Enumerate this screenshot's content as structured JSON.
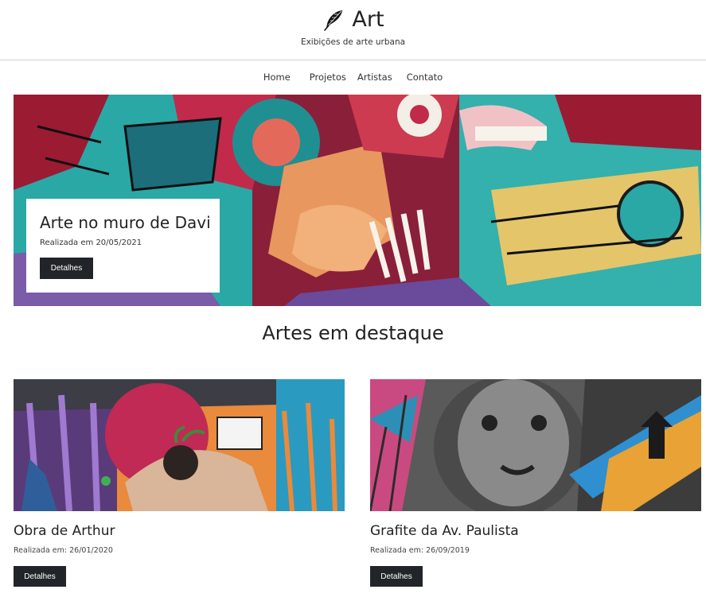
{
  "brand": {
    "title": "Art",
    "tagline": "Exibições de arte urbana",
    "icon": "quill-feather-icon"
  },
  "nav": {
    "items": [
      "Home",
      "Projetos",
      "Artistas",
      "Contato"
    ]
  },
  "hero": {
    "title": "Arte no muro de Davi",
    "date": "Realizada em 20/05/2021",
    "button_label": "Detalhes"
  },
  "featured": {
    "heading": "Artes em destaque",
    "cards": [
      {
        "title": "Obra de Arthur",
        "date": "Realizada em: 26/01/2020",
        "button_label": "Detalhes"
      },
      {
        "title": "Grafite da Av. Paulista",
        "date": "Realizada em: 26/09/2019",
        "button_label": "Detalhes"
      }
    ]
  },
  "colors": {
    "button_bg": "#212529",
    "divider": "#cfcfcf"
  }
}
